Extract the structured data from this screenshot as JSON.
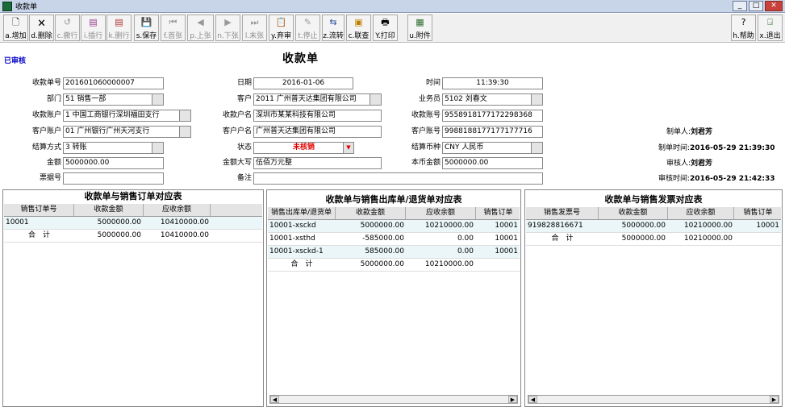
{
  "window": {
    "title": "收款单"
  },
  "toolbar": {
    "items": [
      {
        "label": "a.增加",
        "icon": "add-icon",
        "enabled": true
      },
      {
        "label": "d.删除",
        "icon": "delete-icon",
        "enabled": true
      },
      {
        "label": "c.撤行",
        "icon": "undo-row-icon",
        "enabled": false
      },
      {
        "label": "i.插行",
        "icon": "insert-row-icon",
        "enabled": false
      },
      {
        "label": "k.删行",
        "icon": "delete-row-icon",
        "enabled": false
      },
      {
        "label": "s.保存",
        "icon": "save-icon",
        "enabled": true
      },
      {
        "label": "f.首张",
        "icon": "first-icon",
        "enabled": false
      },
      {
        "label": "p.上张",
        "icon": "prev-icon",
        "enabled": false
      },
      {
        "label": "n.下张",
        "icon": "next-icon",
        "enabled": false
      },
      {
        "label": "l.末张",
        "icon": "last-icon",
        "enabled": false
      },
      {
        "label": "y.弃审",
        "icon": "unapprove-icon",
        "enabled": true
      },
      {
        "label": "t.停止",
        "icon": "stop-icon",
        "enabled": false
      },
      {
        "label": "z.流转",
        "icon": "flow-icon",
        "enabled": true
      },
      {
        "label": "c.联查",
        "icon": "lookup-icon",
        "enabled": true
      },
      {
        "label": "Y.打印",
        "icon": "print-icon",
        "enabled": true
      },
      {
        "label": "u.附件",
        "icon": "attachment-icon",
        "enabled": true
      }
    ],
    "help": {
      "label": "h.帮助",
      "icon": "help-icon"
    },
    "exit": {
      "label": "x.退出",
      "icon": "exit-icon"
    }
  },
  "doc": {
    "status": "已审核",
    "title": "收款单"
  },
  "form": {
    "receipt_no": {
      "label": "收款单号",
      "value": "201601060000007"
    },
    "date": {
      "label": "日期",
      "value": "2016-01-06"
    },
    "time": {
      "label": "时间",
      "value": "11:39:30"
    },
    "dept": {
      "label": "部门",
      "value": "51 销售一部"
    },
    "customer": {
      "label": "客户",
      "value": "2011 广州普天达集团有限公司"
    },
    "salesman": {
      "label": "业务员",
      "value": "5102 刘春文"
    },
    "receipt_account": {
      "label": "收款账户",
      "value": "1 中国工商银行深圳福田支行"
    },
    "receipt_account_name": {
      "label": "收款户名",
      "value": "深圳市某某科技有限公司"
    },
    "receipt_account_no": {
      "label": "收款账号",
      "value": "9558918177172298368"
    },
    "customer_account": {
      "label": "客户账户",
      "value": "01 广州银行广州天河支行"
    },
    "customer_account_name": {
      "label": "客户户名",
      "value": "广州普天达集团有限公司"
    },
    "customer_account_no": {
      "label": "客户账号",
      "value": "9988188177177177716"
    },
    "settle_method": {
      "label": "结算方式",
      "value": "3 转账"
    },
    "state": {
      "label": "状态",
      "value": "未核销"
    },
    "settle_currency": {
      "label": "结算币种",
      "value": "CNY 人民币"
    },
    "amount": {
      "label": "金额",
      "value": "5000000.00"
    },
    "amount_upper": {
      "label": "金额大写",
      "value": "伍佰万元整"
    },
    "local_amount": {
      "label": "本币金额",
      "value": "5000000.00"
    },
    "bill_no": {
      "label": "票据号",
      "value": ""
    },
    "remark": {
      "label": "备注",
      "value": ""
    }
  },
  "meta": {
    "creator_label": "制单人:",
    "creator": "刘君芳",
    "create_time_label": "制单时间:",
    "create_time": "2016-05-29 21:39:30",
    "approver_label": "审核人:",
    "approver": "刘君芳",
    "approve_time_label": "审核时间:",
    "approve_time": "2016-05-29 21:42:33"
  },
  "panel1": {
    "title": "收款单与销售订单对应表",
    "headers": [
      "销售订单号",
      "收款金额",
      "应收余额"
    ],
    "rows": [
      [
        "10001",
        "5000000.00",
        "10410000.00"
      ],
      [
        "合　计",
        "5000000.00",
        "10410000.00"
      ]
    ]
  },
  "panel2": {
    "title": "收款单与销售出库单/退货单对应表",
    "headers": [
      "销售出库单/退货单",
      "收款金额",
      "应收余额",
      "销售订单"
    ],
    "rows": [
      [
        "10001-xsckd",
        "5000000.00",
        "10210000.00",
        "10001"
      ],
      [
        "10001-xsthd",
        "-585000.00",
        "0.00",
        "10001"
      ],
      [
        "10001-xsckd-1",
        "585000.00",
        "0.00",
        "10001"
      ],
      [
        "合　计",
        "5000000.00",
        "10210000.00",
        ""
      ]
    ]
  },
  "panel3": {
    "title": "收款单与销售发票对应表",
    "headers": [
      "销售发票号",
      "收款金额",
      "应收余额",
      "销售订单"
    ],
    "rows": [
      [
        "919828816671",
        "5000000.00",
        "10210000.00",
        "10001"
      ],
      [
        "合　计",
        "5000000.00",
        "10210000.00",
        ""
      ]
    ]
  }
}
